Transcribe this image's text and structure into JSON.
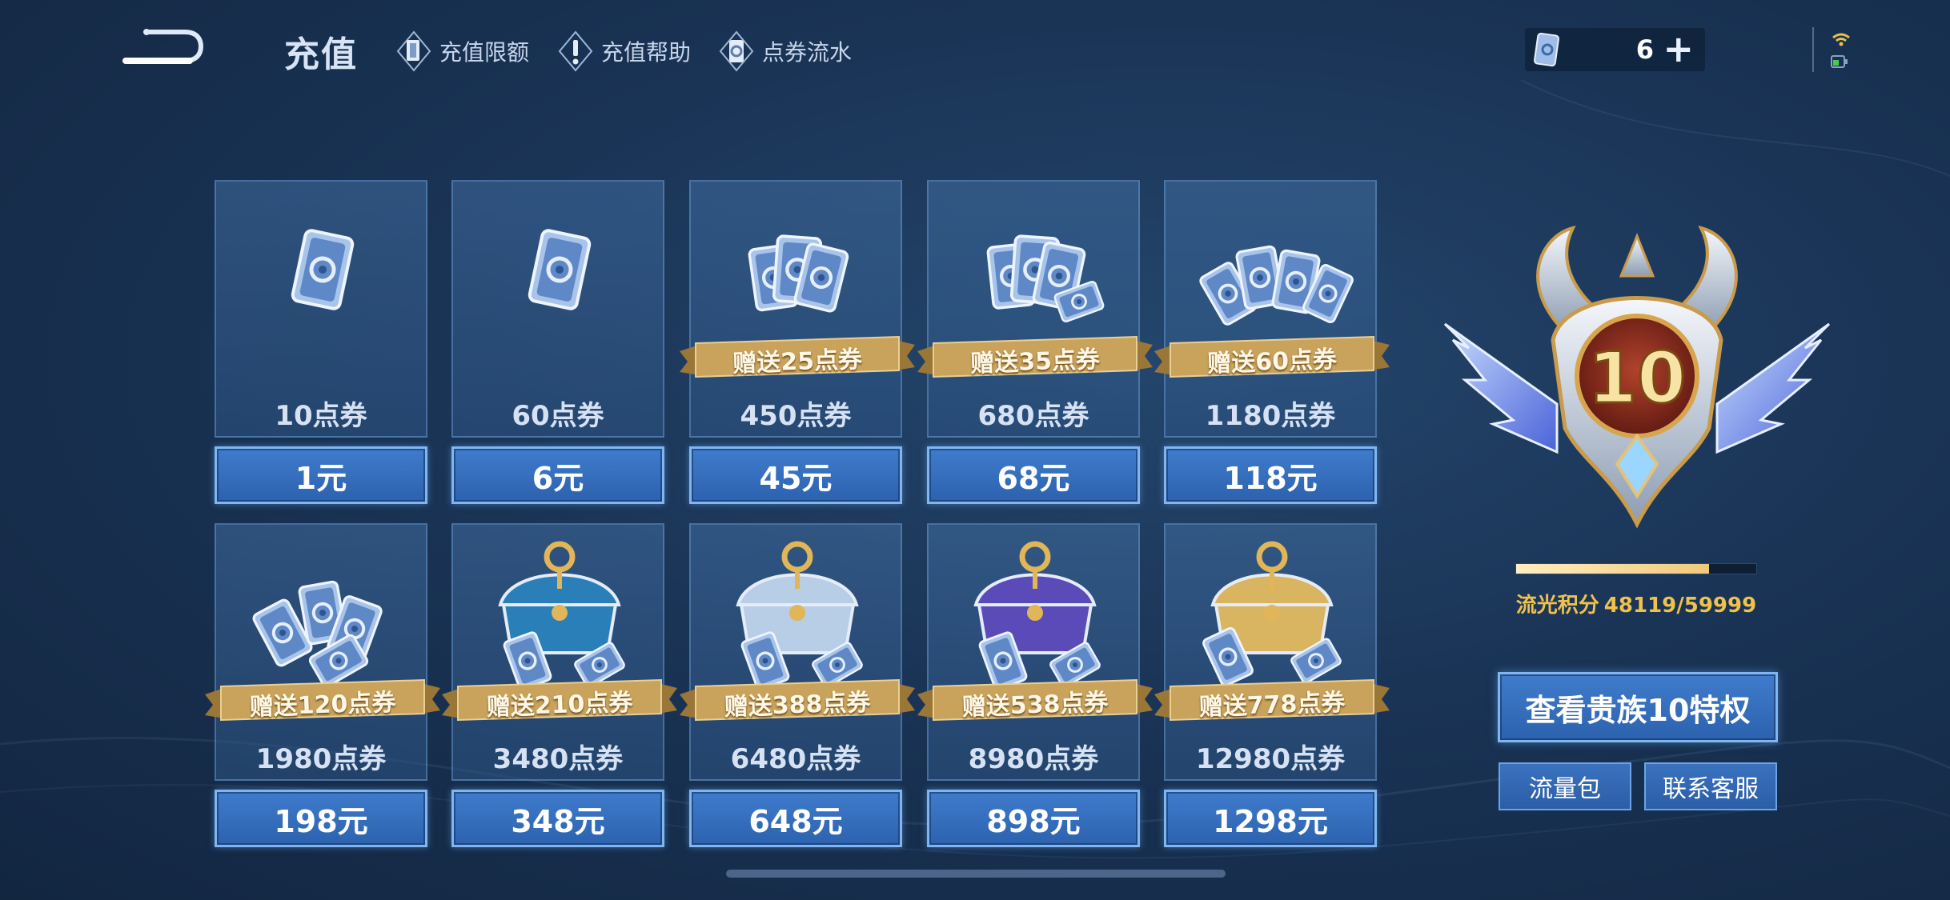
{
  "header": {
    "title": "充值",
    "links": [
      {
        "label": "充值限额",
        "icon": "card-icon"
      },
      {
        "label": "充值帮助",
        "icon": "exclamation-icon"
      },
      {
        "label": "点券流水",
        "icon": "ticket-flow-icon"
      }
    ],
    "currency": {
      "amount": "6",
      "plus": "+"
    }
  },
  "packages": [
    {
      "points": "10点券",
      "price": "1元",
      "bonus": ""
    },
    {
      "points": "60点券",
      "price": "6元",
      "bonus": ""
    },
    {
      "points": "450点券",
      "price": "45元",
      "bonus": "赠送25点券"
    },
    {
      "points": "680点券",
      "price": "68元",
      "bonus": "赠送35点券"
    },
    {
      "points": "1180点券",
      "price": "118元",
      "bonus": "赠送60点券"
    },
    {
      "points": "1980点券",
      "price": "198元",
      "bonus": "赠送120点券"
    },
    {
      "points": "3480点券",
      "price": "348元",
      "bonus": "赠送210点券"
    },
    {
      "points": "6480点券",
      "price": "648元",
      "bonus": "赠送388点券"
    },
    {
      "points": "8980点券",
      "price": "898元",
      "bonus": "赠送538点券"
    },
    {
      "points": "12980点券",
      "price": "1298元",
      "bonus": "赠送778点券"
    }
  ],
  "vip": {
    "level": "10",
    "score_label": "流光积分",
    "score_value": "48119/59999",
    "progress": 0.802,
    "view_button": "查看贵族10特权",
    "traffic_button": "流量包",
    "service_button": "联系客服"
  },
  "colors": {
    "accent": "#3f7ccc",
    "gold": "#f0c14b",
    "ribbon": "#c9a25c",
    "background": "#1a3456"
  }
}
